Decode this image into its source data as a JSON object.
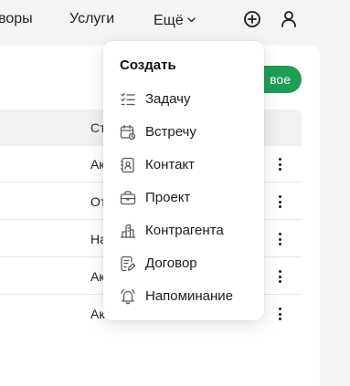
{
  "nav": {
    "item_partial": "воры",
    "services": "Услуги",
    "more": "Ещё"
  },
  "icons": {
    "add": "plus-circle-icon",
    "profile": "user-icon"
  },
  "panel": {
    "new_button_label": "вое",
    "accent_color": "#1f9d55",
    "status_header": "Ст",
    "rows": [
      {
        "status": "Ак"
      },
      {
        "status": "От"
      },
      {
        "status": "На"
      },
      {
        "status": "Ак"
      },
      {
        "status": "Активно"
      }
    ]
  },
  "create_menu": {
    "title": "Создать",
    "items": [
      {
        "label": "Задачу",
        "icon": "task-list-icon"
      },
      {
        "label": "Встречу",
        "icon": "calendar-icon"
      },
      {
        "label": "Контакт",
        "icon": "contact-card-icon"
      },
      {
        "label": "Проект",
        "icon": "briefcase-icon"
      },
      {
        "label": "Контрагента",
        "icon": "counterparty-icon"
      },
      {
        "label": "Договор",
        "icon": "contract-icon"
      },
      {
        "label": "Напоминание",
        "icon": "bell-icon"
      }
    ]
  }
}
